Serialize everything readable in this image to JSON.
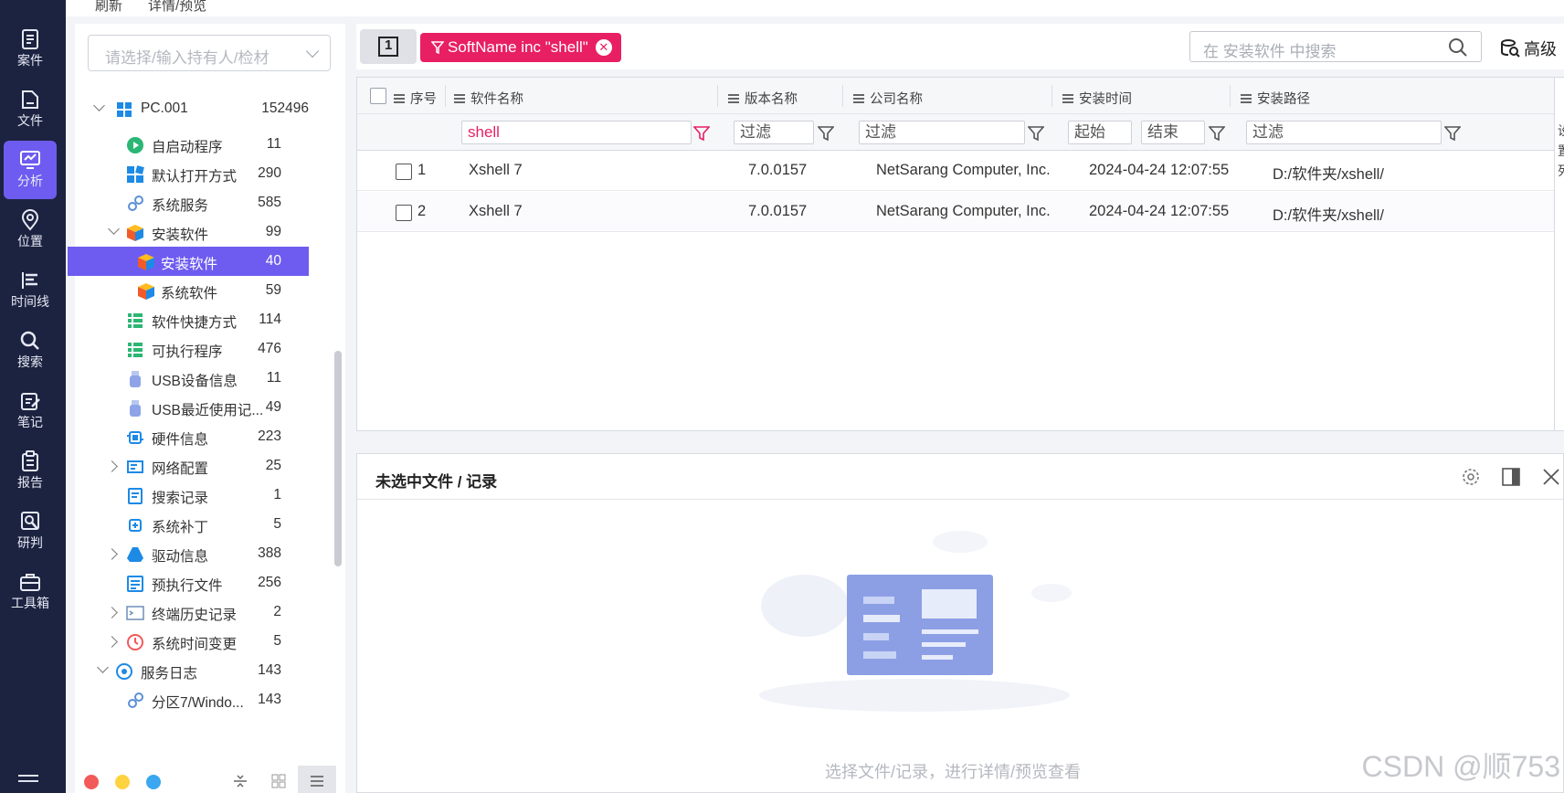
{
  "nav": {
    "items": [
      {
        "label": "案件",
        "icon": "case-icon"
      },
      {
        "label": "文件",
        "icon": "file-icon"
      },
      {
        "label": "分析",
        "icon": "analysis-icon"
      },
      {
        "label": "位置",
        "icon": "location-icon"
      },
      {
        "label": "时间线",
        "icon": "timeline-icon"
      },
      {
        "label": "搜索",
        "icon": "search-icon"
      },
      {
        "label": "笔记",
        "icon": "notes-icon"
      },
      {
        "label": "报告",
        "icon": "report-icon"
      },
      {
        "label": "研判",
        "icon": "judgement-icon"
      },
      {
        "label": "工具箱",
        "icon": "toolbox-icon"
      }
    ],
    "active": "分析"
  },
  "top_strip": {
    "refresh": "刷新",
    "details": "详情/预览"
  },
  "tree": {
    "holder_placeholder": "请选择/输入持有人/检材",
    "root": {
      "label": "PC.001",
      "count": "152496"
    },
    "rows": [
      {
        "label": "自启动程序",
        "count": "11",
        "icon": "autostart-icon"
      },
      {
        "label": "默认打开方式",
        "count": "290",
        "icon": "default-open-icon"
      },
      {
        "label": "系统服务",
        "count": "585",
        "icon": "system-service-icon"
      },
      {
        "label": "安装软件",
        "count": "99",
        "icon": "installed-software-icon"
      },
      {
        "label": "安装软件",
        "count": "40",
        "icon": "installed-software-icon"
      },
      {
        "label": "系统软件",
        "count": "59",
        "icon": "system-software-icon"
      },
      {
        "label": "软件快捷方式",
        "count": "114",
        "icon": "shortcut-icon"
      },
      {
        "label": "可执行程序",
        "count": "476",
        "icon": "executable-icon"
      },
      {
        "label": "USB设备信息",
        "count": "11",
        "icon": "usb-icon"
      },
      {
        "label": "USB最近使用记...",
        "count": "49",
        "icon": "usb-icon"
      },
      {
        "label": "硬件信息",
        "count": "223",
        "icon": "hardware-icon"
      },
      {
        "label": "网络配置",
        "count": "25",
        "icon": "network-icon"
      },
      {
        "label": "搜索记录",
        "count": "1",
        "icon": "search-record-icon"
      },
      {
        "label": "系统补丁",
        "count": "5",
        "icon": "patch-icon"
      },
      {
        "label": "驱动信息",
        "count": "388",
        "icon": "driver-icon"
      },
      {
        "label": "预执行文件",
        "count": "256",
        "icon": "prefetch-icon"
      },
      {
        "label": "终端历史记录",
        "count": "2",
        "icon": "terminal-icon"
      },
      {
        "label": "系统时间变更",
        "count": "5",
        "icon": "clock-icon"
      },
      {
        "label": "服务日志",
        "count": "143",
        "icon": "service-log-icon"
      },
      {
        "label": "分区7/Windo...",
        "count": "143",
        "icon": "partition-icon"
      }
    ]
  },
  "filterbar": {
    "panel_toggle_glyph": "1",
    "chip_label": "SoftName inc \"shell\"",
    "search_placeholder": "在 安装软件 中搜索",
    "advanced_label": "高级"
  },
  "grid": {
    "columns": [
      "序号",
      "软件名称",
      "版本名称",
      "公司名称",
      "安装时间",
      "安装路径"
    ],
    "filters": {
      "name": "shell",
      "version": "过滤",
      "company": "过滤",
      "time_start": "起始",
      "time_end": "结束",
      "path": "过滤"
    },
    "rows": [
      {
        "index": "1",
        "name": "Xshell 7",
        "version": "7.0.0157",
        "company": "NetSarang Computer, Inc.",
        "time": "2024-04-24 12:07:55",
        "path": "D:/软件夹/xshell/"
      },
      {
        "index": "2",
        "name": "Xshell 7",
        "version": "7.0.0157",
        "company": "NetSarang Computer, Inc.",
        "time": "2024-04-24 12:07:55",
        "path": "D:/软件夹/xshell/"
      }
    ],
    "side_labels": [
      "设",
      "置",
      "列"
    ]
  },
  "detail": {
    "title": "未选中文件 / 记录",
    "empty_hint": "选择文件/记录，进行详情/预览查看"
  },
  "watermark": "CSDN @顺753",
  "colors": {
    "nav_bg": "#1c2340",
    "accent": "#6e5cf0",
    "chip": "#e81f63"
  }
}
